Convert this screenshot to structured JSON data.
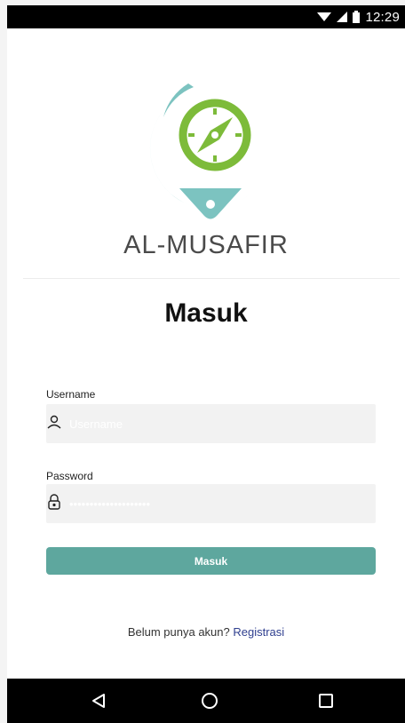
{
  "status_bar": {
    "time": "12:29",
    "icons": [
      "wifi-icon",
      "signal-icon",
      "battery-icon"
    ]
  },
  "app": {
    "brand": "AL-MUSAFIR",
    "logo_icon": "compass-pin-logo"
  },
  "colors": {
    "accent": "#5ea79e",
    "logo_teal": "#7cc3c0",
    "logo_green": "#7dbb3a",
    "link": "#2f3f8f"
  },
  "form": {
    "title": "Masuk",
    "username": {
      "label": "Username",
      "placeholder": "Username",
      "value": "",
      "icon": "user-icon"
    },
    "password": {
      "label": "Password",
      "placeholder": "••••••••••••••••••••",
      "value": "",
      "icon": "lock-icon"
    },
    "submit_label": "Masuk"
  },
  "footer": {
    "prompt": "Belum punya akun?",
    "link_label": "Registrasi"
  },
  "nav_bar": {
    "buttons": [
      "back-icon",
      "home-icon",
      "recents-icon"
    ]
  }
}
